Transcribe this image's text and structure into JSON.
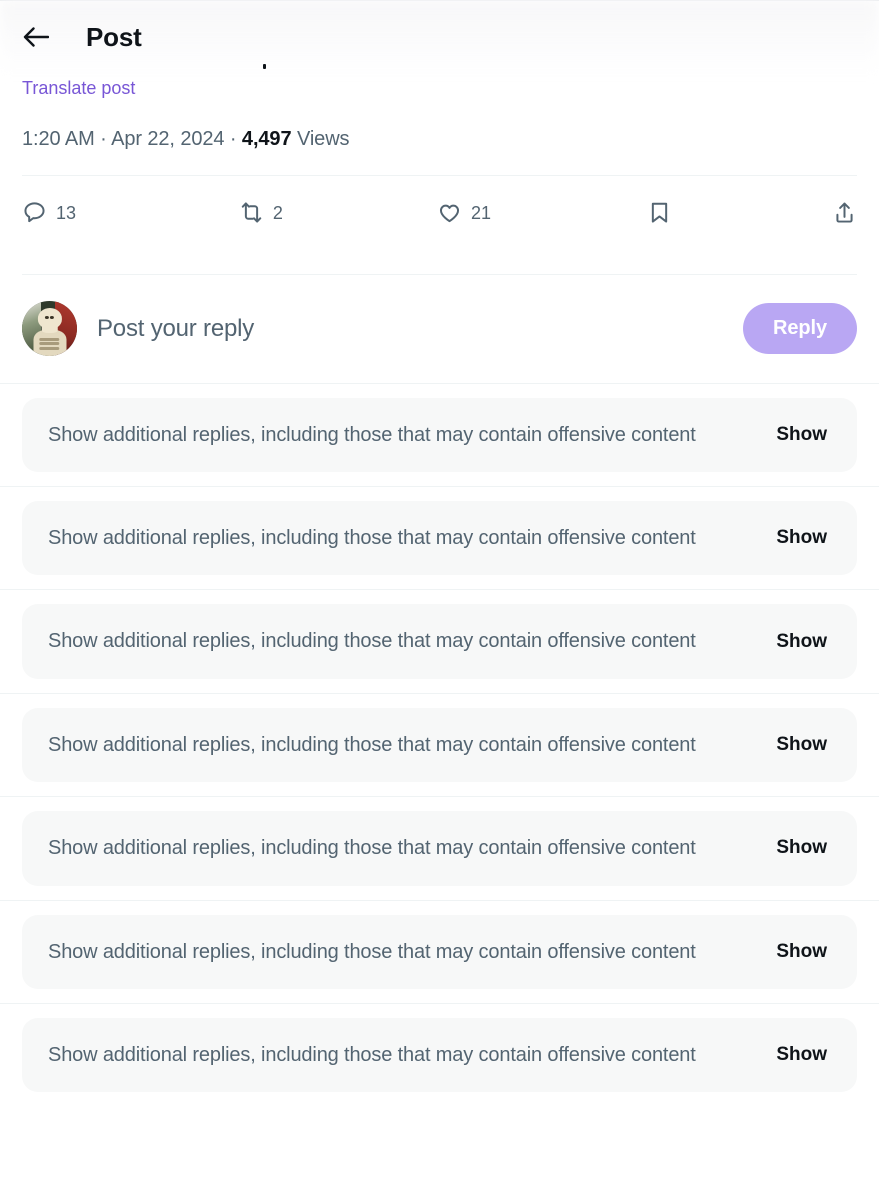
{
  "header": {
    "back_icon": "arrow-left-icon",
    "title": "Post"
  },
  "post_meta": {
    "translate_label": "Translate post",
    "time": "1:20 AM",
    "separator": "·",
    "date": "Apr 22, 2024",
    "views_count": "4,497",
    "views_label": "Views"
  },
  "actions": [
    {
      "name": "reply",
      "icon": "comment-icon",
      "count": "13"
    },
    {
      "name": "repost",
      "icon": "repost-icon",
      "count": "2"
    },
    {
      "name": "like",
      "icon": "heart-icon",
      "count": "21"
    },
    {
      "name": "bookmark",
      "icon": "bookmark-icon",
      "count": ""
    },
    {
      "name": "share",
      "icon": "share-icon",
      "count": ""
    }
  ],
  "composer": {
    "avatar_alt": "skeleton-avatar",
    "placeholder": "Post your reply",
    "reply_button": "Reply"
  },
  "offensive_cards": [
    {
      "text": "Show additional replies, including those that may contain offensive content",
      "action": "Show"
    },
    {
      "text": "Show additional replies, including those that may contain offensive content",
      "action": "Show"
    },
    {
      "text": "Show additional replies, including those that may contain offensive content",
      "action": "Show"
    },
    {
      "text": "Show additional replies, including those that may contain offensive content",
      "action": "Show"
    },
    {
      "text": "Show additional replies, including those that may contain offensive content",
      "action": "Show"
    },
    {
      "text": "Show additional replies, including those that may contain offensive content",
      "action": "Show"
    },
    {
      "text": "Show additional replies, including those that may contain offensive content",
      "action": "Show"
    }
  ],
  "colors": {
    "accent_purple": "#7856d6",
    "reply_button": "#b9a7f3",
    "text_primary": "#0f1419",
    "text_secondary": "#536471",
    "card_bg": "#f7f8f8",
    "divider": "#eff3f4"
  }
}
